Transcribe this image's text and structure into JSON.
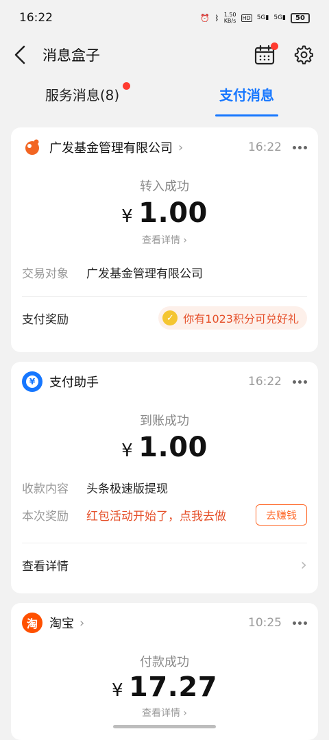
{
  "status": {
    "time": "16:22",
    "speed": "1.50",
    "speed_unit": "KB/s",
    "battery": "50",
    "signal1": "5G",
    "signal2": "5G",
    "hd": "HD"
  },
  "header": {
    "title": "消息盒子"
  },
  "tabs": [
    {
      "label": "服务消息(8)"
    },
    {
      "label": "支付消息"
    }
  ],
  "cards": [
    {
      "source": "广发基金管理有限公司",
      "time": "16:22",
      "event": "转入成功",
      "currency": "¥",
      "amount": "1.00",
      "detail_link": "查看详情",
      "rows": [
        {
          "label": "交易对象",
          "value": "广发基金管理有限公司"
        }
      ],
      "reward_label": "支付奖励",
      "reward_text": "你有1023积分可兑好礼"
    },
    {
      "source": "支付助手",
      "time": "16:22",
      "event": "到账成功",
      "currency": "¥",
      "amount": "1.00",
      "rows": [
        {
          "label": "收款内容",
          "value": "头条极速版提现"
        },
        {
          "label": "本次奖励",
          "value": "红包活动开始了，点我去做"
        }
      ],
      "action_button": "去赚钱",
      "footer_link": "查看详情"
    },
    {
      "source": "淘宝",
      "time": "10:25",
      "event": "付款成功",
      "currency": "¥",
      "amount": "17.27",
      "detail_link": "查看详情"
    }
  ],
  "colors": {
    "accent": "#1677ff",
    "reward": "#e5502a",
    "alert_dot": "#ff3b30"
  }
}
